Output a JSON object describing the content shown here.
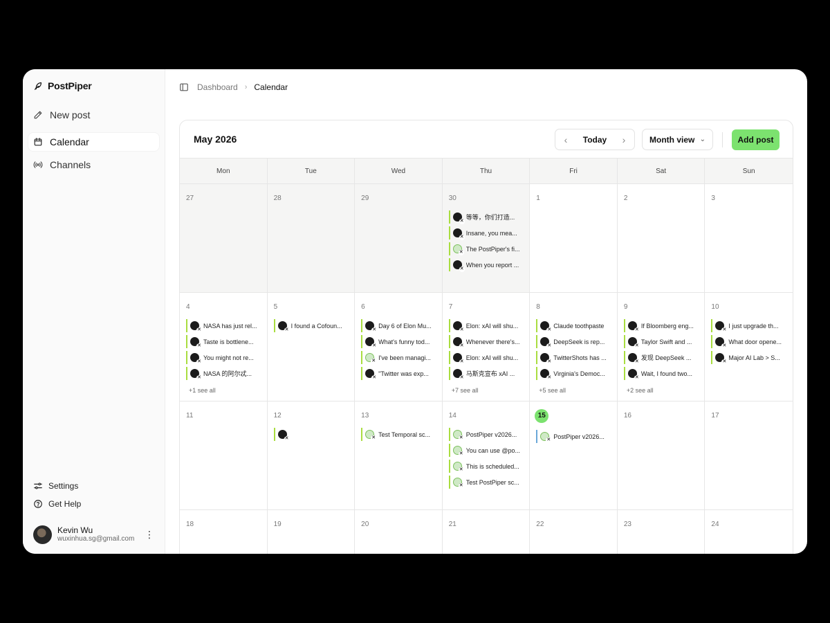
{
  "app": {
    "brand": "PostPiper"
  },
  "nav": [
    {
      "label": "New post",
      "icon": "pen-icon"
    },
    {
      "label": "Calendar",
      "icon": "calendar-icon",
      "active": true
    },
    {
      "label": "Channels",
      "icon": "broadcast-icon"
    }
  ],
  "sidebar_bottom": {
    "settings": "Settings",
    "help": "Get Help"
  },
  "user": {
    "name": "Kevin Wu",
    "email": "wuxinhua.sg@gmail.com"
  },
  "breadcrumb": {
    "parent": "Dashboard",
    "current": "Calendar"
  },
  "calendar": {
    "title": "May 2026",
    "today_label": "Today",
    "view_label": "Month view",
    "add_label": "Add post",
    "weekdays": [
      "Mon",
      "Tue",
      "Wed",
      "Thu",
      "Fri",
      "Sat",
      "Sun"
    ],
    "days": [
      {
        "n": "27",
        "muted": true,
        "posts": []
      },
      {
        "n": "28",
        "muted": true,
        "posts": []
      },
      {
        "n": "29",
        "muted": true,
        "posts": []
      },
      {
        "n": "30",
        "muted": true,
        "posts": [
          {
            "text": "等等，你们打造...",
            "av": "dark"
          },
          {
            "text": "Insane, you mea...",
            "av": "dark"
          },
          {
            "text": "The PostPiper's fi...",
            "av": "light"
          },
          {
            "text": "When you report ...",
            "av": "dark"
          }
        ]
      },
      {
        "n": "1",
        "posts": []
      },
      {
        "n": "2",
        "posts": []
      },
      {
        "n": "3",
        "posts": []
      },
      {
        "n": "4",
        "posts": [
          {
            "text": "NASA has just rel...",
            "av": "dark"
          },
          {
            "text": "Taste is bottlene...",
            "av": "dark"
          },
          {
            "text": "You might not re...",
            "av": "dark"
          },
          {
            "text": "NASA 的阿尔忒...",
            "av": "dark"
          }
        ],
        "more": "+1 see all"
      },
      {
        "n": "5",
        "posts": [
          {
            "text": "I found a Cofoun...",
            "av": "dark"
          }
        ]
      },
      {
        "n": "6",
        "posts": [
          {
            "text": "Day 6 of Elon Mu...",
            "av": "dark"
          },
          {
            "text": "What's funny tod...",
            "av": "dark"
          },
          {
            "text": "I've been managi...",
            "av": "light"
          },
          {
            "text": "\"Twitter was exp...",
            "av": "dark"
          }
        ]
      },
      {
        "n": "7",
        "posts": [
          {
            "text": "Elon: xAI will shu...",
            "av": "dark"
          },
          {
            "text": "Whenever there's...",
            "av": "dark"
          },
          {
            "text": "Elon: xAI will shu...",
            "av": "dark"
          },
          {
            "text": "马斯克宣布 xAI ...",
            "av": "dark"
          }
        ],
        "more": "+7 see all"
      },
      {
        "n": "8",
        "posts": [
          {
            "text": "Claude toothpaste",
            "av": "dark"
          },
          {
            "text": "DeepSeek is rep...",
            "av": "dark"
          },
          {
            "text": "TwitterShots has ...",
            "av": "dark"
          },
          {
            "text": "Virginia's Democ...",
            "av": "dark"
          }
        ],
        "more": "+5 see all"
      },
      {
        "n": "9",
        "posts": [
          {
            "text": "If Bloomberg eng...",
            "av": "dark"
          },
          {
            "text": "Taylor Swift and ...",
            "av": "dark"
          },
          {
            "text": "发现 DeepSeek ...",
            "av": "dark"
          },
          {
            "text": "Wait, I found two...",
            "av": "dark"
          }
        ],
        "more": "+2 see all"
      },
      {
        "n": "10",
        "posts": [
          {
            "text": "I just upgrade th...",
            "av": "dark"
          },
          {
            "text": "What door opene...",
            "av": "dark"
          },
          {
            "text": "Major AI Lab > S...",
            "av": "dark"
          }
        ]
      },
      {
        "n": "11",
        "posts": []
      },
      {
        "n": "12",
        "posts": [
          {
            "text": "",
            "av": "dark"
          }
        ]
      },
      {
        "n": "13",
        "posts": [
          {
            "text": "Test Temporal sc...",
            "av": "light"
          }
        ]
      },
      {
        "n": "14",
        "posts": [
          {
            "text": "PostPiper v2026...",
            "av": "light"
          },
          {
            "text": "You can use @po...",
            "av": "light"
          },
          {
            "text": "This is scheduled...",
            "av": "light"
          },
          {
            "text": "Test PostPiper sc...",
            "av": "light"
          }
        ]
      },
      {
        "n": "15",
        "today": true,
        "posts": [
          {
            "text": "PostPiper v2026...",
            "av": "light",
            "blue": true
          }
        ]
      },
      {
        "n": "16",
        "posts": []
      },
      {
        "n": "17",
        "posts": []
      },
      {
        "n": "18",
        "posts": []
      },
      {
        "n": "19",
        "posts": []
      },
      {
        "n": "20",
        "posts": []
      },
      {
        "n": "21",
        "posts": []
      },
      {
        "n": "22",
        "posts": []
      },
      {
        "n": "23",
        "posts": []
      },
      {
        "n": "24",
        "posts": []
      }
    ]
  },
  "colors": {
    "accent": "#7ce26f",
    "post_bar": "#a9dd3f",
    "post_bar_today": "#6aa7d8",
    "muted_bg": "#f5f5f4"
  }
}
